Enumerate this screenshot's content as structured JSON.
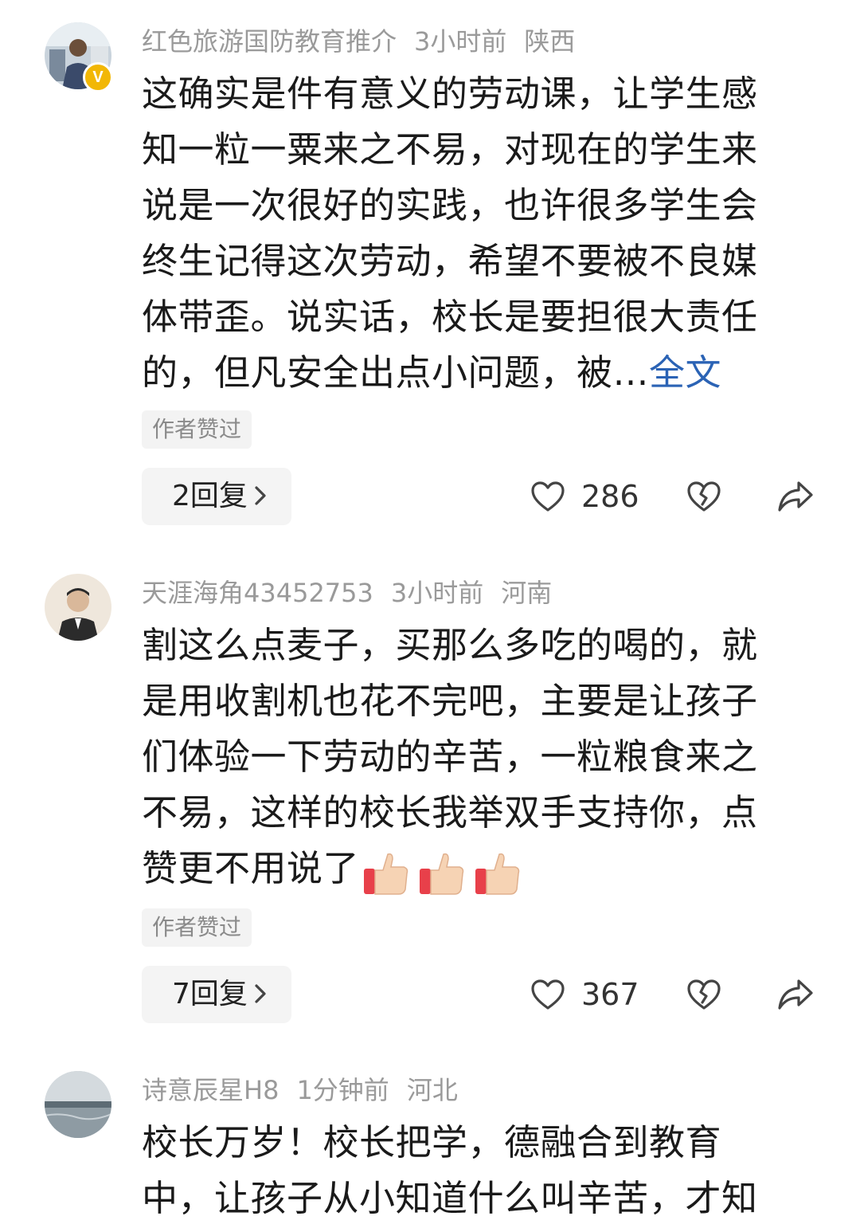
{
  "comments": [
    {
      "username": "红色旅游国防教育推介",
      "time": "3小时前",
      "location": "陕西",
      "verified": true,
      "verified_badge": "V",
      "lines": [
        "这确实是件有意义的劳动课，让学生感",
        "知一粒一粟来之不易，对现在的学生来",
        "说是一次很好的实践，也许很多学生会",
        "终生记得这次劳动，希望不要被不良媒",
        "体带歪。说实话，校长是要担很大责任"
      ],
      "last_line": "的，但凡安全出点小问题，被…",
      "full_text_link": "全文",
      "author_liked": "作者赞过",
      "reply_label": "2回复",
      "like_count": "286"
    },
    {
      "username": "天涯海角43452753",
      "time": "3小时前",
      "location": "河南",
      "lines": [
        "割这么点麦子，买那么多吃的喝的，就",
        "是用收割机也花不完吧，主要是让孩子",
        "们体验一下劳动的辛苦，一粒粮食来之",
        "不易，这样的校长我举双手支持你，点"
      ],
      "last_line": "赞更不用说了",
      "emojis": [
        "thumbs-up-icon",
        "thumbs-up-icon",
        "thumbs-up-icon"
      ],
      "author_liked": "作者赞过",
      "reply_label": "7回复",
      "like_count": "367"
    },
    {
      "username": "诗意辰星H8",
      "time": "1分钟前",
      "location": "河北",
      "lines": [
        "校长万岁！校长把学，德融合到教育",
        "中，让孩子从小知道什么叫辛苦，才知"
      ]
    }
  ],
  "colors": {
    "link": "#2b63b5",
    "meta": "#9a9a9a",
    "badge": "#f2b705"
  }
}
